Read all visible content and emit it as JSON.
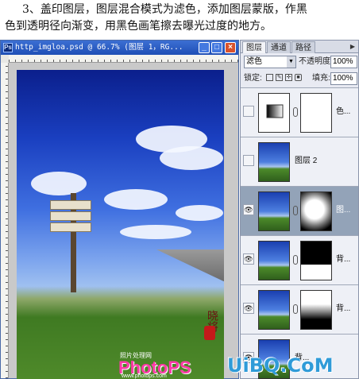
{
  "caption": {
    "line1": "3、盖印图层，图层混合模式为滤色，添加图层蒙版，作黑",
    "line2": "色到透明径向渐变，用黑色画笔擦去曝光过度的地方。"
  },
  "document_window": {
    "title": "http_imgloa.psd @ 66.7% (图层 1，RG...",
    "buttons": {
      "minimize": "_",
      "maximize": "□",
      "close": "×"
    }
  },
  "photo": {
    "watermark_text": "PhotoPS",
    "watermark_small": "照片处理网",
    "watermark_url": "www.photops.com",
    "calligraphy": "晓将"
  },
  "layers_panel": {
    "tabs": [
      {
        "label": "图层",
        "active": true
      },
      {
        "label": "通道",
        "active": false
      },
      {
        "label": "路径",
        "active": false
      }
    ],
    "blend_mode": "滤色",
    "opacity_label": "不透明度:",
    "opacity_value": "100%",
    "lock_label": "锁定:",
    "fill_label": "填充:",
    "fill_value": "100%",
    "layers": [
      {
        "name": "色...",
        "visible": false,
        "selected": false
      },
      {
        "name": "图层 2",
        "visible": false,
        "selected": false
      },
      {
        "name": "图...",
        "visible": true,
        "selected": true
      },
      {
        "name": "背...",
        "visible": true,
        "selected": false
      },
      {
        "name": "背...",
        "visible": true,
        "selected": false
      },
      {
        "name": "背...",
        "visible": true,
        "selected": false
      }
    ]
  },
  "site_watermark": "UiBQ.CoM",
  "colors": {
    "accent": "#1f4fb6",
    "selected_layer": "#93a3b8",
    "site_watermark": "#2f9bd8"
  }
}
